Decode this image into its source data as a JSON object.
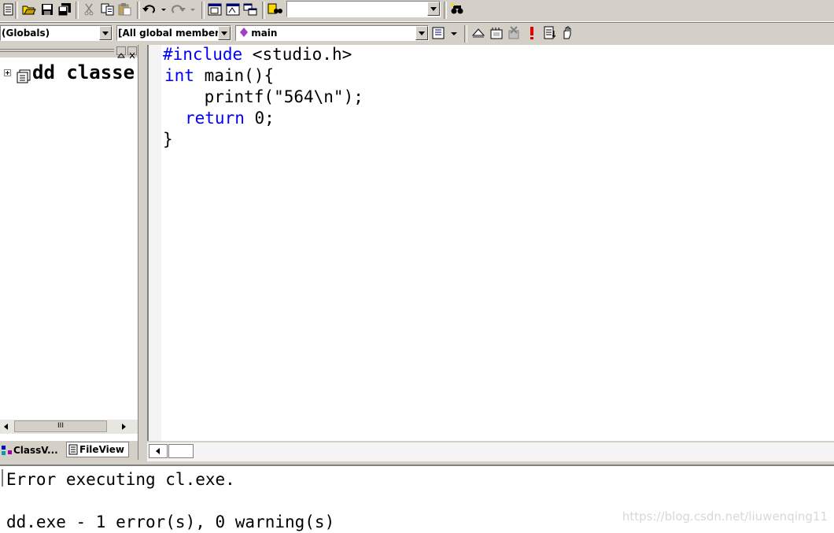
{
  "toolbar1": {
    "buttons": [
      "new-text-file-icon",
      "open-icon",
      "save-icon",
      "save-all-icon",
      "cut-icon",
      "copy-icon",
      "paste-icon",
      "undo-icon",
      "redo-icon",
      "workspace-icon",
      "output-icon",
      "window-list-icon",
      "find-in-files-icon",
      "find-icon"
    ],
    "find_value": ""
  },
  "toolbar2": {
    "scope_combo": "(Globals)",
    "members_combo": "[All global member",
    "function_combo": "main"
  },
  "leftpane": {
    "tree_root_label": "dd classe",
    "scroll_grip": "III",
    "tabs": [
      {
        "label": "ClassV..."
      },
      {
        "label": "FileView"
      }
    ]
  },
  "editor": {
    "lines": [
      {
        "kw": "#include",
        "rest": " <studio.h>"
      },
      {
        "kw": "int",
        "rest": " main(){"
      },
      {
        "kw": "",
        "rest": "    printf(\"564\\n\");"
      },
      {
        "kw": "return",
        "rest": " 0;"
      },
      {
        "kw": "",
        "rest": "}"
      }
    ]
  },
  "output": {
    "line1": "Error executing cl.exe.",
    "line2": "dd.exe - 1 error(s), 0 warning(s)"
  },
  "watermark": "https://blog.csdn.net/liuwenqing11",
  "colors": {
    "keyword": "#0000ff",
    "chrome": "#d4d0c8",
    "watermark": "#d8d8d8"
  }
}
